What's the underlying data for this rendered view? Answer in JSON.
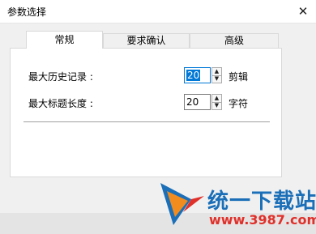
{
  "window": {
    "title": "参数选择",
    "close_glyph": "✕"
  },
  "tabs": [
    {
      "label": "常规",
      "active": true
    },
    {
      "label": "要求确认",
      "active": false
    },
    {
      "label": "高级",
      "active": false
    }
  ],
  "settings": {
    "history": {
      "label": "最大历史记录 :",
      "value": "20",
      "unit": "剪辑"
    },
    "title_length": {
      "label": "最大标题长度 :",
      "value": "20",
      "unit": "字符"
    }
  },
  "spinner": {
    "up_icon": "▲",
    "down_icon": "▼"
  },
  "watermark": {
    "name": "统一下载站",
    "url": "www.3987.com",
    "colors": {
      "blue": "#1a6fb8",
      "red": "#e0302a",
      "orange": "#f28c1e"
    }
  },
  "colors": {
    "accent": "#0078d7",
    "panel": "#ffffff",
    "background": "#f0f0f0"
  }
}
